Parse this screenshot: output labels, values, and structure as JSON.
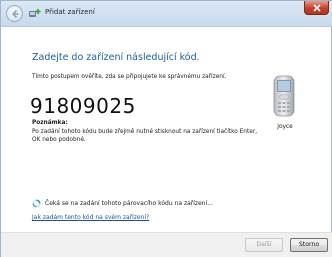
{
  "window": {
    "title": "Přidat zařízení"
  },
  "content": {
    "heading": "Zadejte do zařízení následující kód.",
    "intro": "Tímto postupem ověříte, zda se připojujete ke správnému zařízení.",
    "code": "91809025",
    "note_label": "Poznámka:",
    "note_text": "Po zadání tohoto kódu bude zřejmě nutné stisknout na zařízení tlačítko Enter, OK nebo podobné.",
    "device_name": "Joyce",
    "status_text": "Čeká se na zadání tohoto párovacího kódu na zařízení...",
    "help_link": "Jak zadám tento kód na svém zařízení?"
  },
  "buttons": {
    "next": "Další",
    "cancel": "Storno"
  },
  "colors": {
    "heading": "#1e5fa8",
    "link": "#1f4fa3",
    "close": "#c2412a"
  },
  "icons": {
    "back": "back-arrow-icon",
    "wizard": "add-device-icon",
    "close": "close-icon",
    "device": "mobile-phone-icon",
    "spinner": "busy-spinner-icon"
  }
}
